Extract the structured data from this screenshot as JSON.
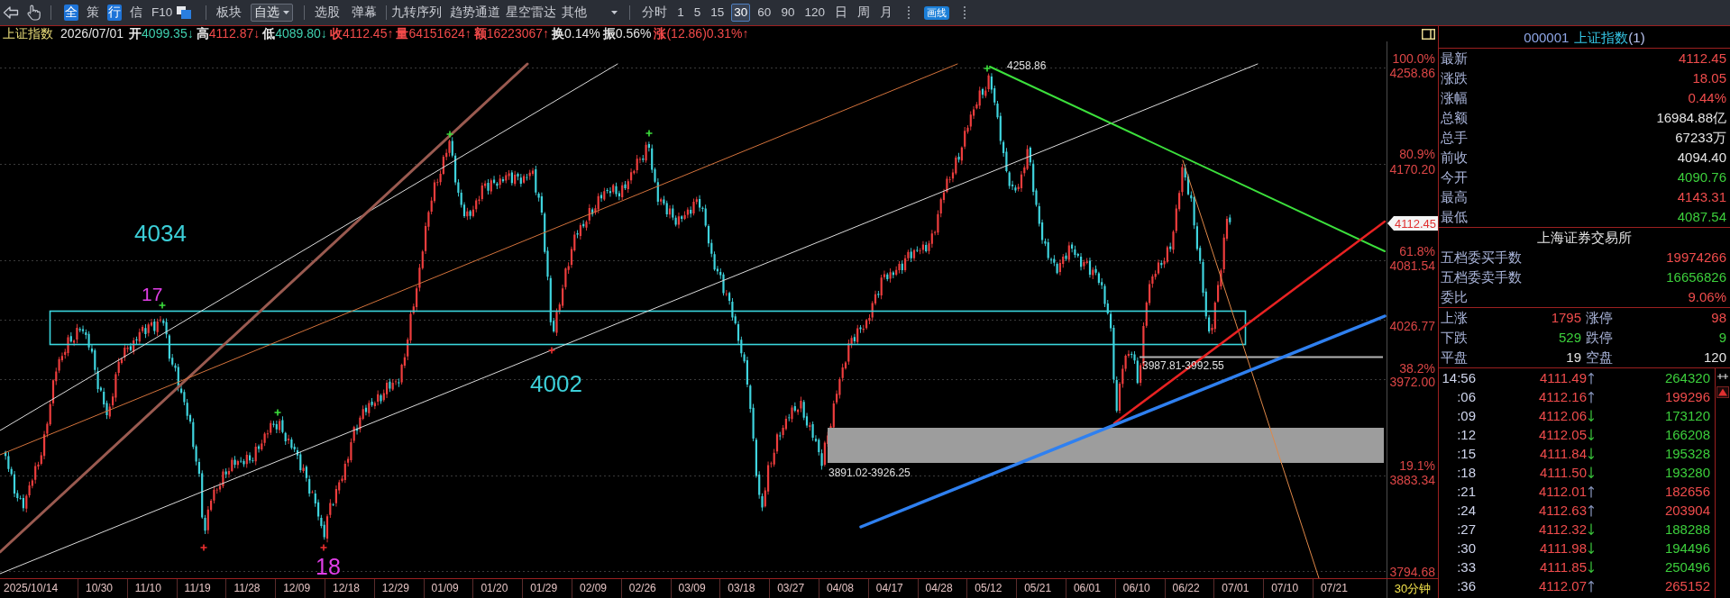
{
  "toolbar": {
    "view_tabs": [
      {
        "label": "全",
        "selected": true
      },
      {
        "label": "策",
        "selected": false
      },
      {
        "label": "行",
        "selected": true
      },
      {
        "label": "信",
        "selected": false
      },
      {
        "label": "F10",
        "selected": false
      }
    ],
    "menu_groups": [
      [
        {
          "label": "板块",
          "kind": "button",
          "selected": false
        },
        {
          "label": "自选",
          "kind": "dropdown",
          "selected": true
        }
      ],
      [
        {
          "label": "选股",
          "kind": "button",
          "selected": false
        },
        {
          "label": "弹幕",
          "kind": "button",
          "selected": false
        }
      ],
      [
        {
          "label": "九转序列",
          "kind": "button",
          "selected": false
        },
        {
          "label": "趋势通道",
          "kind": "button",
          "selected": false
        },
        {
          "label": "星空雷达",
          "kind": "button",
          "selected": false
        },
        {
          "label": "其他",
          "kind": "dropdown",
          "selected": false
        }
      ]
    ],
    "periods": [
      {
        "label": "分时",
        "selected": false
      },
      {
        "label": "1",
        "selected": false
      },
      {
        "label": "5",
        "selected": false
      },
      {
        "label": "15",
        "selected": false
      },
      {
        "label": "30",
        "selected": true
      },
      {
        "label": "60",
        "selected": false
      },
      {
        "label": "90",
        "selected": false
      },
      {
        "label": "120",
        "selected": false
      },
      {
        "label": "日",
        "selected": false
      },
      {
        "label": "周",
        "selected": false
      },
      {
        "label": "月",
        "selected": false
      }
    ],
    "draw_button": "画线"
  },
  "quote_bar": {
    "name": "上证指数",
    "date": "2026/07/01",
    "fields": [
      {
        "label": {
          "text": "开",
          "color": "#e6e6e6"
        },
        "value": {
          "text": "4099.35↓",
          "color": "#3fcfae"
        }
      },
      {
        "label": {
          "text": "高",
          "color": "#e6e6e6"
        },
        "value": {
          "text": "4112.87↓",
          "color": "#f24a4a"
        }
      },
      {
        "label": {
          "text": "低",
          "color": "#e6e6e6"
        },
        "value": {
          "text": "4089.80↓",
          "color": "#3fcfae"
        }
      },
      {
        "label": {
          "text": "收",
          "color": "#f24a4a"
        },
        "value": {
          "text": "4112.45↑",
          "color": "#f24a4a"
        }
      },
      {
        "label": {
          "text": "量",
          "color": "#f24a4a"
        },
        "value": {
          "text": "64151624↑",
          "color": "#f24a4a"
        }
      },
      {
        "label": {
          "text": "额",
          "color": "#f24a4a"
        },
        "value": {
          "text": "16223067↑",
          "color": "#f24a4a"
        }
      },
      {
        "label": {
          "text": "换",
          "color": "#e6e6e6"
        },
        "value": {
          "text": "0.14%",
          "color": "#e6e6e6"
        }
      },
      {
        "label": {
          "text": "振",
          "color": "#e6e6e6"
        },
        "value": {
          "text": "0.56%",
          "color": "#e6e6e6"
        }
      },
      {
        "label": {
          "text": "涨",
          "color": "#f24a4a"
        },
        "value": {
          "text": "(12.86)0.31%↑",
          "color": "#f24a4a"
        }
      }
    ]
  },
  "chart": {
    "annotations": [
      {
        "kind": "level",
        "text": "4034"
      },
      {
        "kind": "count",
        "text": "17"
      },
      {
        "kind": "level",
        "text": "4002"
      },
      {
        "kind": "count",
        "text": "18"
      },
      {
        "kind": "price",
        "text": "4258.86"
      },
      {
        "kind": "price",
        "text": "3987.81-3992.55"
      },
      {
        "kind": "price",
        "text": "3891.02-3926.25"
      }
    ],
    "price_axis": [
      {
        "percent": "100.0%",
        "price": "4258.86"
      },
      {
        "percent": "80.9%",
        "price": "4170.20"
      },
      {
        "percent": "61.8%",
        "price": "4081.54"
      },
      {
        "price": "4026.77"
      },
      {
        "percent": "38.2%",
        "price": "3972.00"
      },
      {
        "percent": "19.1%",
        "price": "3883.34"
      },
      {
        "price": "3794.68"
      }
    ],
    "last_price": "4112.45",
    "dates": [
      "2025/10/14",
      "10/30",
      "11/10",
      "11/19",
      "11/28",
      "12/09",
      "12/18",
      "12/29",
      "01/09",
      "01/20",
      "01/29",
      "02/09",
      "02/26",
      "03/09",
      "03/18",
      "03/27",
      "04/08",
      "04/17",
      "04/28",
      "05/12",
      "05/21",
      "06/01",
      "06/10",
      "06/22",
      "07/01",
      "07/10",
      "07/21"
    ],
    "period": "30分钟"
  },
  "quote_panel": {
    "code": "000001",
    "name": "上证指数",
    "suffix": "(1)",
    "rows": [
      {
        "label": "最新",
        "value": "4112.45",
        "color": "#f04c4c"
      },
      {
        "label": "涨跌",
        "value": "18.05",
        "color": "#f04c4c"
      },
      {
        "label": "涨幅",
        "value": "0.44%",
        "color": "#f04c4c"
      },
      {
        "label": "总额",
        "value": "16984.88亿",
        "color": "#e4e4e4"
      },
      {
        "label": "总手",
        "value": "67233万",
        "color": "#e4e4e4"
      },
      {
        "label": "前收",
        "value": "4094.40",
        "color": "#e4e4e4"
      },
      {
        "label": "今开",
        "value": "4090.76",
        "color": "#3ccf3c"
      },
      {
        "label": "最高",
        "value": "4143.31",
        "color": "#f04c4c"
      },
      {
        "label": "最低",
        "value": "4087.54",
        "color": "#3ccf3c"
      }
    ],
    "exchange": "上海证券交易所",
    "order_rows": [
      {
        "label": "五档委买手数",
        "value": "19974266",
        "color": "#f04c4c"
      },
      {
        "label": "五档委卖手数",
        "value": "16656826",
        "color": "#3ccf3c"
      },
      {
        "label": "委比",
        "value": "9.06%",
        "color": "#f04c4c"
      }
    ],
    "breadth_rows": [
      {
        "left": {
          "label": "上涨",
          "value": "1795",
          "color": "#f04c4c"
        },
        "right": {
          "label": "涨停",
          "value": "98",
          "color": "#f04c4c"
        }
      },
      {
        "left": {
          "label": "下跌",
          "value": "529",
          "color": "#3ccf3c"
        },
        "right": {
          "label": "跌停",
          "value": "9",
          "color": "#3ccf3c"
        }
      },
      {
        "left": {
          "label": "平盘",
          "value": "19",
          "color": "#e4e4e4"
        },
        "right": {
          "label": "空盘",
          "value": "120",
          "color": "#e4e4e4"
        }
      }
    ]
  },
  "ticks": [
    {
      "time": "14:56",
      "price": "4111.49",
      "rising": true,
      "volume": {
        "text": "264320",
        "color": "#3ccf3c"
      }
    },
    {
      "time": ":06",
      "price": "4112.16",
      "rising": true,
      "volume": {
        "text": "199296",
        "color": "#f04c4c"
      }
    },
    {
      "time": ":09",
      "price": "4112.06",
      "rising": false,
      "volume": {
        "text": "173120",
        "color": "#3ccf3c"
      }
    },
    {
      "time": ":12",
      "price": "4112.05",
      "rising": false,
      "volume": {
        "text": "166208",
        "color": "#3ccf3c"
      }
    },
    {
      "time": ":15",
      "price": "4111.84",
      "rising": false,
      "volume": {
        "text": "195328",
        "color": "#3ccf3c"
      }
    },
    {
      "time": ":18",
      "price": "4111.50",
      "rising": false,
      "volume": {
        "text": "193280",
        "color": "#3ccf3c"
      }
    },
    {
      "time": ":21",
      "price": "4112.01",
      "rising": true,
      "volume": {
        "text": "182656",
        "color": "#f04c4c"
      }
    },
    {
      "time": ":24",
      "price": "4112.63",
      "rising": true,
      "volume": {
        "text": "203904",
        "color": "#f04c4c"
      }
    },
    {
      "time": ":27",
      "price": "4112.32",
      "rising": false,
      "volume": {
        "text": "188288",
        "color": "#3ccf3c"
      }
    },
    {
      "time": ":30",
      "price": "4111.98",
      "rising": false,
      "volume": {
        "text": "194496",
        "color": "#3ccf3c"
      }
    },
    {
      "time": ":33",
      "price": "4111.85",
      "rising": false,
      "volume": {
        "text": "250496",
        "color": "#3ccf3c"
      }
    },
    {
      "time": ":36",
      "price": "4112.07",
      "rising": true,
      "volume": {
        "text": "265152",
        "color": "#f04c4c"
      }
    }
  ]
}
